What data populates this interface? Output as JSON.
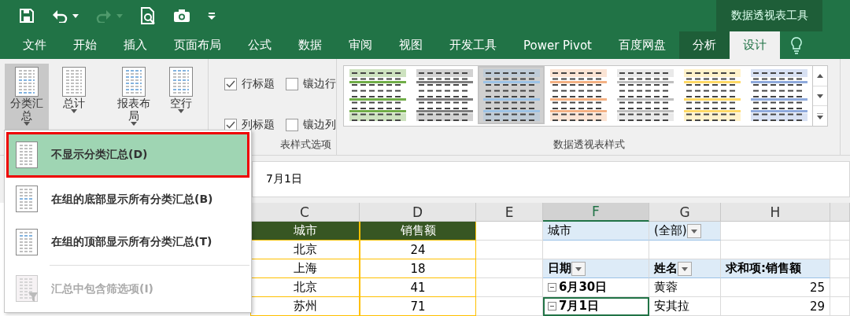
{
  "context_group": {
    "title": "数据透视表工具"
  },
  "tabs": [
    {
      "label": "文件",
      "selected": false,
      "contextual": false
    },
    {
      "label": "开始",
      "selected": false,
      "contextual": false
    },
    {
      "label": "插入",
      "selected": false,
      "contextual": false
    },
    {
      "label": "页面布局",
      "selected": false,
      "contextual": false
    },
    {
      "label": "公式",
      "selected": false,
      "contextual": false
    },
    {
      "label": "数据",
      "selected": false,
      "contextual": false
    },
    {
      "label": "审阅",
      "selected": false,
      "contextual": false
    },
    {
      "label": "视图",
      "selected": false,
      "contextual": false
    },
    {
      "label": "开发工具",
      "selected": false,
      "contextual": false
    },
    {
      "label": "Power Pivot",
      "selected": false,
      "contextual": false
    },
    {
      "label": "百度网盘",
      "selected": false,
      "contextual": false
    },
    {
      "label": "分析",
      "selected": false,
      "contextual": true
    },
    {
      "label": "设计",
      "selected": true,
      "contextual": true
    }
  ],
  "ribbon": {
    "layout_buttons": [
      {
        "label": "分类汇总",
        "pressed": true
      },
      {
        "label": "总计",
        "pressed": false
      },
      {
        "label": "报表布局",
        "pressed": false
      },
      {
        "label": "空行",
        "pressed": false
      }
    ],
    "options": [
      {
        "label": "行标题",
        "checked": true
      },
      {
        "label": "镶边行",
        "checked": false
      },
      {
        "label": "列标题",
        "checked": true
      },
      {
        "label": "镶边列",
        "checked": false
      }
    ],
    "options_group_label": "表样式选项",
    "styles": [
      {
        "color": "#70ad47",
        "selected": false
      },
      {
        "color": "#7f7f7f",
        "selected": false
      },
      {
        "color": "#9dc3e6",
        "selected": true
      },
      {
        "color": "#f4b183",
        "selected": false
      },
      {
        "color": "#bfbfbf",
        "selected": false
      },
      {
        "color": "#ffd966",
        "selected": false
      },
      {
        "color": "#8faadc",
        "selected": false
      }
    ],
    "styles_group_label": "数据透视表样式"
  },
  "formula_bar": {
    "value": "7月1日"
  },
  "sheet": {
    "columns": [
      {
        "label": "C",
        "selected": false
      },
      {
        "label": "D",
        "selected": false
      },
      {
        "label": "E",
        "selected": false
      },
      {
        "label": "F",
        "selected": true
      },
      {
        "label": "G",
        "selected": false
      },
      {
        "label": "H",
        "selected": false
      }
    ],
    "source_table": {
      "headers": [
        "城市",
        "销售额"
      ],
      "rows": [
        [
          "北京",
          "24"
        ],
        [
          "上海",
          "18"
        ],
        [
          "北京",
          "41"
        ],
        [
          "苏州",
          "71"
        ]
      ]
    },
    "pivot": {
      "filter": {
        "label": "城市",
        "value": "(全部)"
      },
      "headers": [
        "日期",
        "姓名",
        "求和项:销售额"
      ],
      "rows": [
        {
          "date": "6月30日",
          "name": "黄蓉",
          "amount": "25",
          "expanded": true,
          "selected": false
        },
        {
          "date": "7月1日",
          "name": "安其拉",
          "amount": "29",
          "expanded": true,
          "selected": true
        }
      ]
    }
  },
  "subtotal_menu": {
    "items": [
      {
        "label": "不显示分类汇总(D)",
        "selected": true,
        "disabled": false
      },
      {
        "label": "在组的底部显示所有分类汇总(B)",
        "selected": false,
        "disabled": false
      },
      {
        "label": "在组的顶部显示所有分类汇总(T)",
        "selected": false,
        "disabled": false
      },
      {
        "label": "汇总中包含筛选项(I)",
        "selected": false,
        "disabled": true
      }
    ]
  }
}
